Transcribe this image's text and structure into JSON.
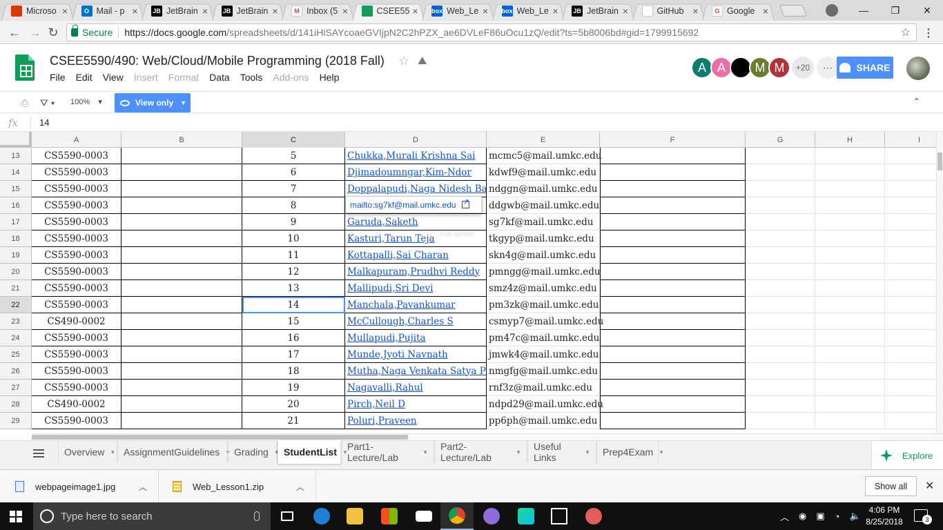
{
  "browser": {
    "tabs": [
      {
        "title": "Microso",
        "color": "#d83b01",
        "glyph": ""
      },
      {
        "title": "Mail - p",
        "color": "#0072c6",
        "glyph": "O"
      },
      {
        "title": "JetBrain",
        "color": "#000000",
        "glyph": "JB"
      },
      {
        "title": "JetBrain",
        "color": "#000000",
        "glyph": "JB"
      },
      {
        "title": "Inbox (5",
        "color": "#ffffff",
        "glyph": "M"
      },
      {
        "title": "CSEE55",
        "color": "#0f9d58",
        "glyph": ""
      },
      {
        "title": "Web_Le",
        "color": "#0061d5",
        "glyph": "box"
      },
      {
        "title": "Web_Le",
        "color": "#0061d5",
        "glyph": "box"
      },
      {
        "title": "JetBrain",
        "color": "#000000",
        "glyph": "JB"
      },
      {
        "title": "GitHub",
        "color": "#ffffff",
        "glyph": ""
      },
      {
        "title": "Google",
        "color": "#ffffff",
        "glyph": "G"
      }
    ],
    "active_tab": 5,
    "secure_label": "Secure",
    "url_host": "https://docs.google.com",
    "url_path": "/spreadsheets/d/141iHiSAYcoaeGVIjpN2C2hPZX_ae6DVLeF86uOcu1zQ/edit?ts=5b8006bd#gid=1799915692"
  },
  "doc": {
    "title": "CSEE5590/490: Web/Cloud/Mobile Programming (2018 Fall)",
    "menu": [
      {
        "label": "File",
        "disabled": false
      },
      {
        "label": "Edit",
        "disabled": false
      },
      {
        "label": "View",
        "disabled": false
      },
      {
        "label": "Insert",
        "disabled": true
      },
      {
        "label": "Format",
        "disabled": true
      },
      {
        "label": "Data",
        "disabled": false
      },
      {
        "label": "Tools",
        "disabled": false
      },
      {
        "label": "Add-ons",
        "disabled": true
      },
      {
        "label": "Help",
        "disabled": false
      }
    ],
    "collaborators": [
      {
        "initial": "A",
        "color": "#0e7c6f"
      },
      {
        "initial": "A",
        "color": "#ec6fa3"
      },
      {
        "initial": "",
        "color": "#000000"
      },
      {
        "initial": "M",
        "color": "#6b7d2e"
      },
      {
        "initial": "M",
        "color": "#b0323a"
      }
    ],
    "more_collaborators": "+20",
    "share_label": "SHARE"
  },
  "toolbar": {
    "zoom": "100%",
    "view_only_label": "View only"
  },
  "formula": {
    "fx_label": "fx",
    "value": "14"
  },
  "grid": {
    "columns": [
      "A",
      "B",
      "C",
      "D",
      "E",
      "F",
      "G",
      "H",
      "I"
    ],
    "selected_column": "C",
    "selected_row": "22",
    "rows": [
      {
        "num": "13",
        "a": "CS5590-0003",
        "c": "5",
        "d": "Chukka,Murali Krishna Sai",
        "e": "mcmc5@mail.umkc.edu"
      },
      {
        "num": "14",
        "a": "CS5590-0003",
        "c": "6",
        "d": "Djimadoumngar,Kim-Ndor",
        "e": "kdwf9@mail.umkc.edu"
      },
      {
        "num": "15",
        "a": "CS5590-0003",
        "c": "7",
        "d": "Doppalapudi,Naga Nidesh Bab",
        "e": "ndggn@mail.umkc.edu"
      },
      {
        "num": "16",
        "a": "CS5590-0003",
        "c": "8",
        "d": "",
        "e": "ddgwb@mail.umkc.edu"
      },
      {
        "num": "17",
        "a": "CS5590-0003",
        "c": "9",
        "d": "Garuda,Saketh",
        "e": "sg7kf@mail.umkc.edu"
      },
      {
        "num": "18",
        "a": "CS5590-0003",
        "c": "10",
        "d": "Kasturi,Tarun Teja",
        "e": "tkgyp@mail.umkc.edu"
      },
      {
        "num": "19",
        "a": "CS5590-0003",
        "c": "11",
        "d": "Kottapalli,Sai Charan",
        "e": "skn4g@mail.umkc.edu"
      },
      {
        "num": "20",
        "a": "CS5590-0003",
        "c": "12",
        "d": "Malkapuram,Prudhvi Reddy",
        "e": "pmngg@mail.umkc.edu"
      },
      {
        "num": "21",
        "a": "CS5590-0003",
        "c": "13",
        "d": "Mallipudi,Sri Devi",
        "e": "smz4z@mail.umkc.edu"
      },
      {
        "num": "22",
        "a": "CS5590-0003",
        "c": "14",
        "d": "Manchala,Pavankumar",
        "e": "pm3zk@mail.umkc.edu"
      },
      {
        "num": "23",
        "a": "CS490-0002",
        "c": "15",
        "d": "McCullough,Charles S",
        "e": "csmyp7@mail.umkc.edu"
      },
      {
        "num": "24",
        "a": "CS5590-0003",
        "c": "16",
        "d": "Mullapudi,Pujita",
        "e": "pm47c@mail.umkc.edu"
      },
      {
        "num": "25",
        "a": "CS5590-0003",
        "c": "17",
        "d": "Munde,Jyoti Navnath",
        "e": "jmwk4@mail.umkc.edu"
      },
      {
        "num": "26",
        "a": "CS5590-0003",
        "c": "18",
        "d": "Mutha,Naga Venkata Satya Pra",
        "e": "nmgfg@mail.umkc.edu"
      },
      {
        "num": "27",
        "a": "CS5590-0003",
        "c": "19",
        "d": "Nagavalli,Rahul",
        "e": "rnf3z@mail.umkc.edu"
      },
      {
        "num": "28",
        "a": "CS490-0002",
        "c": "20",
        "d": "Pirch,Neil D",
        "e": "ndpd29@mail.umkc.edu"
      },
      {
        "num": "29",
        "a": "CS5590-0003",
        "c": "21",
        "d": "Poluri,Praveen",
        "e": "pp6ph@mail.umkc.edu"
      }
    ],
    "link_tooltip": "mailto:sg7kf@mail.umkc.edu",
    "ghost_text": "Full-screen"
  },
  "sheet_tabs": {
    "tabs": [
      "Overview",
      "AssignmentGuidelines",
      "Grading",
      "StudentList",
      "Part1-Lecture/Lab",
      "Part2-Lecture/Lab",
      "Useful Links",
      "Prep4Exam"
    ],
    "active": "StudentList",
    "explore_label": "Explore"
  },
  "downloads": {
    "items": [
      "webpageimage1.jpg",
      "Web_Lesson1.zip"
    ],
    "show_all_label": "Show all"
  },
  "taskbar": {
    "search_placeholder": "Type here to search",
    "time": "4:06 PM",
    "date": "8/25/2018",
    "notification_count": "3"
  }
}
